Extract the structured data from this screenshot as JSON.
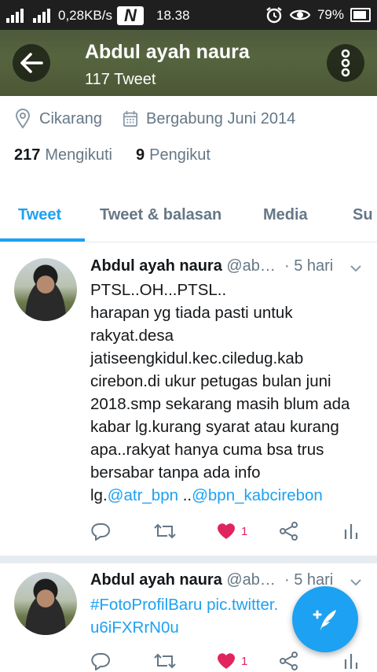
{
  "status_bar": {
    "network_speed": "0,28KB/s",
    "time": "18.38",
    "battery": "79%",
    "icons": [
      "signal-icon",
      "netflix-icon",
      "alarm-icon",
      "eye-icon",
      "battery-icon"
    ]
  },
  "header": {
    "title": "Abdul ayah naura",
    "subtitle": "117 Tweet",
    "icons": [
      "back-arrow-icon",
      "more-vertical-icon"
    ]
  },
  "profile": {
    "location": "Cikarang",
    "joined": "Bergabung Juni 2014",
    "following_count": "217",
    "following_label": "Mengikuti",
    "followers_count": "9",
    "followers_label": "Pengikut"
  },
  "tabs": [
    {
      "label": "Tweet",
      "active": true
    },
    {
      "label": "Tweet & balasan",
      "active": false
    },
    {
      "label": "Media",
      "active": false
    },
    {
      "label": "Su",
      "active": false
    }
  ],
  "tweets": [
    {
      "name": "Abdul ayah naura",
      "handle": "@ab…",
      "time": "· 5 hari",
      "lines": [
        "PTSL..OH...PTSL..",
        "harapan yg tiada pasti untuk",
        "rakyat.desa",
        "jatiseengkidul.kec.ciledug.kab",
        "cirebon.di ukur petugas bulan juni",
        "2018.smp sekarang masih blum ada",
        "kabar lg.kurang syarat atau kurang",
        "apa..rakyat hanya cuma bsa trus",
        "bersabar tanpa ada info"
      ],
      "last_line_prefix": "lg.",
      "mention_1": "@atr_bpn",
      "between": " ..",
      "mention_2": "@bpn_kabcirebon",
      "like_count": "1"
    },
    {
      "name": "Abdul ayah naura",
      "handle": "@ab…",
      "time": "· 5 hari",
      "hashtag": "#FotoProfilBaru",
      "link_1": " pic.twitter.",
      "link_2": "u6iFXRrN0u",
      "like_count": "1"
    }
  ],
  "colors": {
    "accent": "#1da1f2",
    "like": "#e0245e",
    "muted": "#657786",
    "header_bg": "#4f5c3a"
  }
}
